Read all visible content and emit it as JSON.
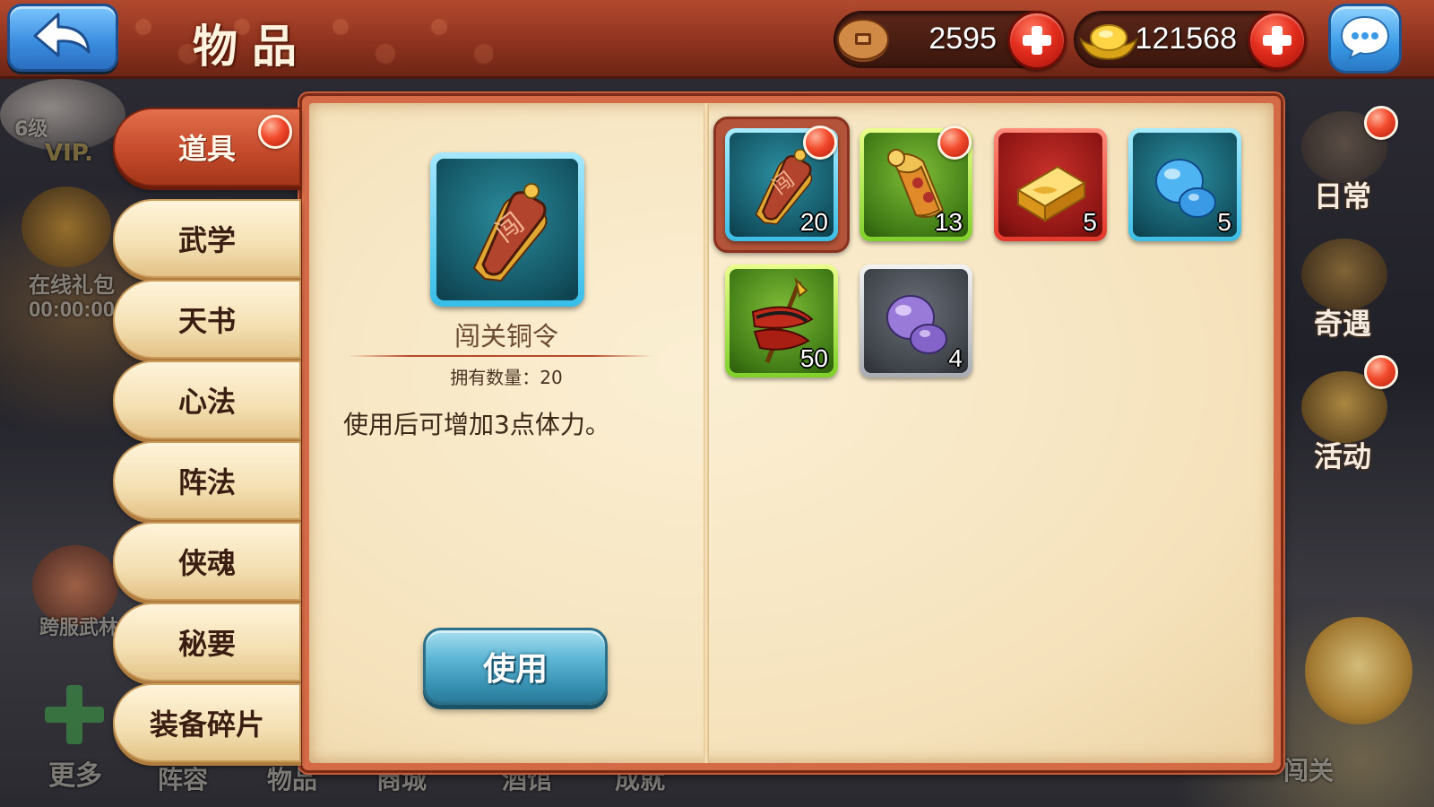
{
  "header": {
    "title": "物品",
    "copper": "2595",
    "gold": "121568"
  },
  "background": {
    "level": "6级",
    "vip": "VIP.",
    "online_gift": "在线礼包",
    "online_timer": "00:00:00",
    "cross_server": "跨服武林",
    "more": "更多",
    "bottom_tabs": [
      "阵容",
      "物品",
      "商城",
      "酒馆",
      "成就"
    ],
    "bottom_right": "闯关"
  },
  "tabs": [
    {
      "label": "道具",
      "active": true,
      "badge": true
    },
    {
      "label": "武学",
      "active": false
    },
    {
      "label": "天书",
      "active": false
    },
    {
      "label": "心法",
      "active": false
    },
    {
      "label": "阵法",
      "active": false
    },
    {
      "label": "侠魂",
      "active": false
    },
    {
      "label": "秘要",
      "active": false
    },
    {
      "label": "装备碎片",
      "active": false
    }
  ],
  "detail": {
    "name": "闯关铜令",
    "owned": "拥有数量：20",
    "description": "使用后可增加3点体力。",
    "use_label": "使用",
    "icon": "bronze-token-icon"
  },
  "items": [
    {
      "icon": "bronze-token-icon",
      "count": "20",
      "rarity": "blue",
      "selected": true,
      "badge": true
    },
    {
      "icon": "scroll-icon",
      "count": "13",
      "rarity": "green",
      "badge": true
    },
    {
      "icon": "gold-bar-icon",
      "count": "5",
      "rarity": "red"
    },
    {
      "icon": "blue-gourd-icon",
      "count": "5",
      "rarity": "blue"
    },
    {
      "icon": "spear-ribbon-icon",
      "count": "50",
      "rarity": "green"
    },
    {
      "icon": "purple-gourd-icon",
      "count": "4",
      "rarity": "gray"
    }
  ],
  "side_buttons": [
    {
      "label": "日常",
      "icon": "scroll-icon",
      "badge": true
    },
    {
      "label": "奇遇",
      "icon": "treasure-chest-icon"
    },
    {
      "label": "活动",
      "icon": "gong-icon",
      "badge": true
    }
  ],
  "colors": {
    "header_red": "#8f3320",
    "panel_parchment": "#f5e2bb",
    "active_tab": "#c54b2c",
    "badge_red": "#f24a2c",
    "use_button": "#5cb5d4"
  }
}
